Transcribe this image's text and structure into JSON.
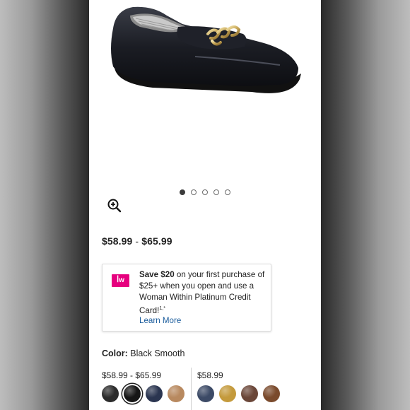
{
  "product": {
    "price_low": "$58.99",
    "price_sep": "-",
    "price_high": "$65.99"
  },
  "carousel": {
    "dot_count": 5,
    "active_index": 0
  },
  "promo": {
    "logo_text": "ꟾw",
    "bold_text": "Save $20",
    "text_1": " on your first purchase of $25+ when you open and use a Woman Within Platinum Credit Card!",
    "superscript": "1,*",
    "link": "Learn More"
  },
  "color": {
    "label": "Color:",
    "value": "Black Smooth"
  },
  "swatch_groups": [
    {
      "price": "$58.99 - $65.99",
      "swatches": [
        {
          "name": "black-croc",
          "color": "#2b2b2b",
          "selected": false
        },
        {
          "name": "black-smooth",
          "color": "#161616",
          "selected": true
        },
        {
          "name": "navy",
          "color": "#2a3550",
          "selected": false
        },
        {
          "name": "tan",
          "color": "#b8895f",
          "selected": false
        }
      ]
    },
    {
      "price": "$58.99",
      "swatches": [
        {
          "name": "navy-pattern",
          "color": "#3c4a66",
          "selected": false
        },
        {
          "name": "gold-pattern",
          "color": "#c49a3c",
          "selected": false
        },
        {
          "name": "brown-pattern",
          "color": "#6a4638",
          "selected": false
        },
        {
          "name": "cognac-pattern",
          "color": "#7a4a2c",
          "selected": false
        }
      ]
    }
  ],
  "colors": {
    "accent_link": "#1a5c9c",
    "brand_pink": "#e6007e"
  }
}
